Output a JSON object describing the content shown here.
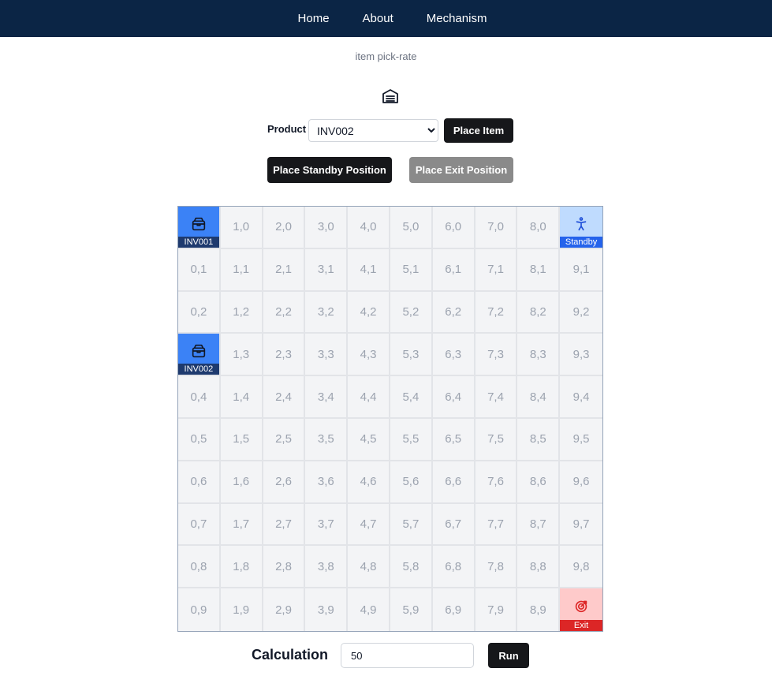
{
  "nav": {
    "items": [
      "Home",
      "About",
      "Mechanism"
    ]
  },
  "page": {
    "subtitle": "item pick-rate",
    "header_icon": "warehouse-icon"
  },
  "product": {
    "label": "Product",
    "selected": "INV002",
    "options": [
      "INV002"
    ],
    "place_item_label": "Place Item"
  },
  "actions": {
    "standby_label": "Place Standby Position",
    "exit_label": "Place Exit Position"
  },
  "grid": {
    "cols": 10,
    "rows": 10,
    "items": [
      {
        "col": 0,
        "row": 0,
        "label": "INV001",
        "icon": "box-icon"
      },
      {
        "col": 0,
        "row": 3,
        "label": "INV002",
        "icon": "box-icon"
      }
    ],
    "standby": {
      "col": 9,
      "row": 0,
      "label": "Standby",
      "icon": "person-icon"
    },
    "exit": {
      "col": 9,
      "row": 9,
      "label": "Exit",
      "icon": "target-icon"
    }
  },
  "calc": {
    "label": "Calculation",
    "value": "50",
    "run_label": "Run"
  },
  "colors": {
    "navbar": "#0b2545",
    "item": "#3b82f6",
    "item_tag": "#1e3a6e",
    "standby": "#bfdbfe",
    "standby_tag": "#2563eb",
    "exit": "#fecaca",
    "exit_tag": "#dc2626"
  }
}
